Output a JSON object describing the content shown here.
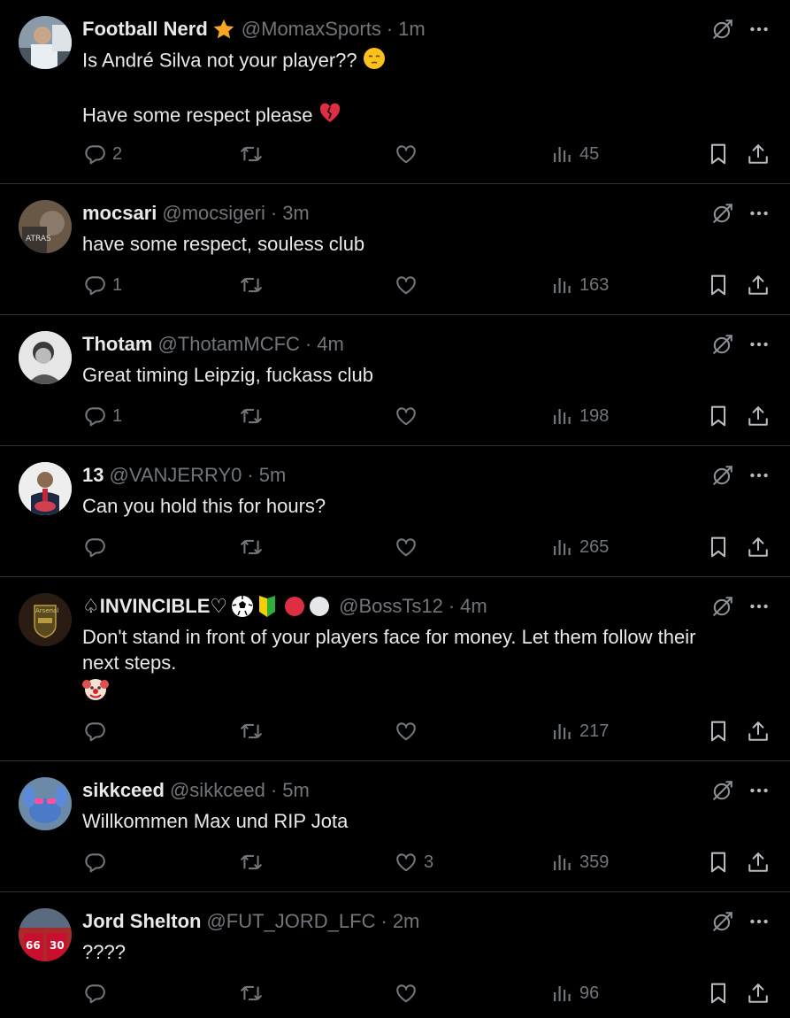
{
  "tweets": [
    {
      "name": "Football Nerd",
      "handle": "@MomaxSports",
      "time": "1m",
      "lines": [
        "Is André Silva not your player??",
        "",
        "Have some respect please"
      ],
      "line_emojis": [
        "pensive-emoji",
        "",
        "broken-heart-emoji"
      ],
      "replies": "2",
      "retweets": "",
      "likes": "",
      "views": "45",
      "avatar_color": "#6b7a8a"
    },
    {
      "name": "mocsari",
      "handle": "@mocsigeri",
      "time": "3m",
      "lines": [
        "have some respect, souless club"
      ],
      "replies": "1",
      "retweets": "",
      "likes": "",
      "views": "163",
      "avatar_color": "#5a4a3a"
    },
    {
      "name": "Thotam",
      "handle": "@ThotamMCFC",
      "time": "4m",
      "lines": [
        "Great timing Leipzig, fuckass club"
      ],
      "replies": "1",
      "retweets": "",
      "likes": "",
      "views": "198",
      "avatar_color": "#d8d8d8"
    },
    {
      "name": "13",
      "handle": "@VANJERRY0",
      "time": "5m",
      "lines": [
        "Can you hold this for hours?"
      ],
      "replies": "",
      "retweets": "",
      "likes": "",
      "views": "265",
      "avatar_color": "#e8e8e8"
    },
    {
      "name": "♤INVINCIBLE♡",
      "handle": "@BossTs12",
      "time": "4m",
      "lines": [
        "Don't stand in front of your players face for money. Let them follow their",
        "next steps.",
        ""
      ],
      "line_emojis": [
        "",
        "",
        "clown-emoji"
      ],
      "replies": "",
      "retweets": "",
      "likes": "",
      "views": "217",
      "avatar_color": "#3a2a1a"
    },
    {
      "name": "sikkceed",
      "handle": "@sikkceed",
      "time": "5m",
      "lines": [
        "Willkommen Max und RIP Jota"
      ],
      "replies": "",
      "retweets": "",
      "likes": "3",
      "views": "359",
      "avatar_color": "#4a6080"
    },
    {
      "name": "Jord Shelton",
      "handle": "@FUT_JORD_LFC",
      "time": "2m",
      "lines": [
        "????"
      ],
      "replies": "",
      "retweets": "",
      "likes": "",
      "views": "96",
      "avatar_color": "#8a1a1a"
    }
  ],
  "icons": {
    "reply": "reply-icon",
    "retweet": "retweet-icon",
    "like": "like-icon",
    "views": "views-icon",
    "bookmark": "bookmark-icon",
    "share": "share-icon",
    "grok": "grok-icon",
    "more": "more-icon"
  },
  "colors": {
    "background": "#000000",
    "text": "#e7e9ea",
    "muted": "#71767b",
    "separator": "#2f3336"
  }
}
